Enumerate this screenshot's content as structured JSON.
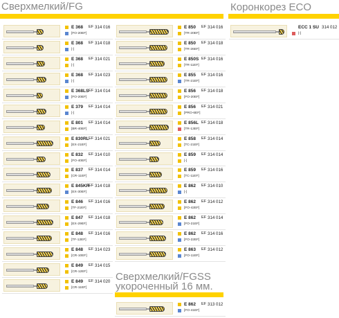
{
  "sections": {
    "fg_title": "Сверхмелкий/FG",
    "eco_title": "Коронкорез ECO",
    "fgss_title": "Сверхмелкий/FGSS\nукороченный 16 мм."
  },
  "colors": {
    "accent_yellow": "#ffd200",
    "badge_blue": "#5a86d0",
    "badge_red": "#dd5c5c"
  },
  "col1": [
    {
      "code": "E 368",
      "ef": "EF",
      "num": "314 016",
      "ref": "[FO-20EF]",
      "badge": "blue"
    },
    {
      "code": "E 368",
      "ef": "EF",
      "num": "314 018",
      "ref": "[-]",
      "badge": "blue"
    },
    {
      "code": "E 368",
      "ef": "EF",
      "num": "314 021",
      "ref": "[-]",
      "badge": "yellow"
    },
    {
      "code": "E 368",
      "ef": "EF",
      "num": "314 023",
      "ref": "[-]",
      "badge": "blue"
    },
    {
      "code": "E 368LS",
      "ef": "EF",
      "num": "314 014",
      "ref": "[FO-20EF]",
      "badge": "blue"
    },
    {
      "code": "E 379",
      "ef": "EF",
      "num": "314 014",
      "ref": "[-]",
      "badge": "blue"
    },
    {
      "code": "E 801",
      "ef": "EF",
      "num": "314 014",
      "ref": "[BR-40EF]",
      "badge": "yellow"
    },
    {
      "code": "E 830RL",
      "ef": "EF",
      "num": "314 021",
      "ref": "[EX-21EF]",
      "badge": "yellow"
    },
    {
      "code": "E 832",
      "ef": "EF",
      "num": "314 010",
      "ref": "[FO-40EF]",
      "badge": "yellow"
    },
    {
      "code": "E 837",
      "ef": "EF",
      "num": "314 014",
      "ref": "[CR-11EF]",
      "badge": "yellow"
    },
    {
      "code": "E 845KR",
      "ef": "EF",
      "num": "314 018",
      "ref": "[EX-30EF]",
      "badge": "blue"
    },
    {
      "code": "E 846",
      "ef": "EF",
      "num": "314 016",
      "ref": "[TF-21EF]",
      "badge": "yellow"
    },
    {
      "code": "E 847",
      "ef": "EF",
      "num": "314 018",
      "ref": "[EX-29EF]",
      "badge": "yellow"
    },
    {
      "code": "E 848",
      "ef": "EF",
      "num": "314 016",
      "ref": "[TF-12EF]",
      "badge": "yellow"
    },
    {
      "code": "E 848",
      "ef": "EF",
      "num": "314 023",
      "ref": "[CR-10EF]",
      "badge": "yellow"
    },
    {
      "code": "E 849",
      "ef": "EF",
      "num": "314 015",
      "ref": "[CR-12EF]",
      "badge": "yellow"
    },
    {
      "code": "E 849",
      "ef": "EF",
      "num": "314 020",
      "ref": "[CR-11EF]",
      "badge": "yellow"
    }
  ],
  "col2": [
    {
      "code": "E 850",
      "ef": "EF",
      "num": "314 016",
      "ref": "[TR-20EF]",
      "badge": "yellow"
    },
    {
      "code": "E 850",
      "ef": "EF",
      "num": "314 018",
      "ref": "[TR-26EF]",
      "badge": "yellow"
    },
    {
      "code": "E 850S",
      "ef": "EF",
      "num": "314 016",
      "ref": "[TR-11EF]",
      "badge": "yellow"
    },
    {
      "code": "E 855",
      "ef": "EF",
      "num": "314 016",
      "ref": "[TR-21EF]",
      "badge": "blue"
    },
    {
      "code": "E 856",
      "ef": "EF",
      "num": "314 018",
      "ref": "[FO-20EF]",
      "badge": "yellow"
    },
    {
      "code": "E 856",
      "ef": "EF",
      "num": "314 021",
      "ref": "[PRO-6EF]",
      "badge": "yellow"
    },
    {
      "code": "E 856L",
      "ef": "EF",
      "num": "314 018",
      "ref": "[TR-13EF]",
      "badge": "red"
    },
    {
      "code": "E 858",
      "ef": "EF",
      "num": "314 014",
      "ref": "[TC-21EF]",
      "badge": "yellow"
    },
    {
      "code": "E 859",
      "ef": "EF",
      "num": "314 014",
      "ref": "[-]",
      "badge": "yellow"
    },
    {
      "code": "E 859",
      "ef": "EF",
      "num": "314 016",
      "ref": "[TC-11EF]",
      "badge": "yellow"
    },
    {
      "code": "E 862",
      "ef": "EF",
      "num": "314 010",
      "ref": "[-]",
      "badge": "blue"
    },
    {
      "code": "E 862",
      "ef": "EF",
      "num": "314 012",
      "ref": "[FO-42EF]",
      "badge": "yellow"
    },
    {
      "code": "E 862",
      "ef": "EF",
      "num": "314 014",
      "ref": "[FO-21EF]",
      "badge": "blue"
    },
    {
      "code": "E 862",
      "ef": "EF",
      "num": "314 016",
      "ref": "[FO-22EF]",
      "badge": "blue"
    },
    {
      "code": "E 863",
      "ef": "EF",
      "num": "314 012",
      "ref": "[FO-11EF]",
      "badge": "blue"
    }
  ],
  "fgss_rows": [
    {
      "code": "E 862",
      "ef": "EF",
      "num": "313 012",
      "ref": "[FO-41EF]",
      "badge": "blue"
    }
  ],
  "eco_rows": [
    {
      "code": "ECC 1 SU",
      "ef": "",
      "num": "314 012",
      "ref": "[-]",
      "badge": "red"
    }
  ]
}
